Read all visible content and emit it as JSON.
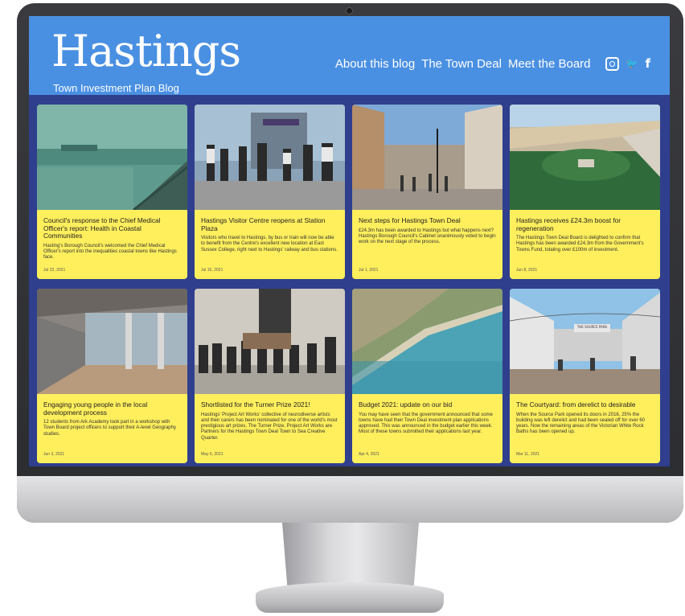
{
  "site": {
    "brand": "Hastings",
    "tagline": "Town Investment Plan Blog",
    "accent_color": "#4a90e2",
    "card_color": "#ffef5d",
    "background_color": "#2f3f8e"
  },
  "nav": {
    "items": [
      "About this blog",
      "The Town Deal",
      "Meet the Board"
    ],
    "social_icons": [
      "instagram-icon",
      "twitter-icon",
      "facebook-icon"
    ],
    "twitter_glyph": "🐦",
    "facebook_glyph": "f"
  },
  "posts": [
    {
      "title": "Council's response to the Chief Medical Officer's report: Health in Coastal Communities",
      "excerpt": "Hasting's Borough Council's welcomed the Chief Medical Officer's report into the inequalities coastal towns like Hastings face.",
      "date": "Jul 22, 2021",
      "image": "seafront-promenade-photo"
    },
    {
      "title": "Hastings Visitor Centre reopens at Station Plaza",
      "excerpt": "Visitors who travel to Hastings, by bus or train will now be able to benefit from the Centre's excellent new location at East Sussex College, right next to Hastings' railway and bus stations.",
      "date": "Jul 15, 2021",
      "image": "group-at-visitor-centre-photo"
    },
    {
      "title": "Next steps for Hastings Town Deal",
      "excerpt": "£24.3m has been awarded to Hastings but what happens next? Hastings Borough Council's Cabinet unanimously voted to begin work on the next stage of the process.",
      "date": "Jul 1, 2021",
      "image": "town-high-street-photo"
    },
    {
      "title": "Hastings receives £24.3m boost for regeneration",
      "excerpt": "The Hastings Town Deal Board is delighted to confirm that Hastings has been awarded £24.3m from the Government's Towns Fund, totaling over £100m of investment.",
      "date": "Jun 8, 2021",
      "image": "coastal-aerial-castle-photo"
    },
    {
      "title": "Engaging young people in the local development process",
      "excerpt": "12 students from Ark Academy took part in a workshop with Town Board project officers to support their A-level Geography studies.",
      "date": "Jun 3, 2021",
      "image": "covered-walkway-photo"
    },
    {
      "title": "Shortlisted for the Turner Prize 2021!",
      "excerpt": "Hastings' Project Art Works' collective of neurodiverse artists and their carers has been nominated for one of the world's most prestigious art prizes. The Turner Prize. Project Art Works are Partners for the Hastings Town Deal Town to Sea Creative Quarter.",
      "date": "May 6, 2021",
      "image": "artists-group-photo"
    },
    {
      "title": "Budget 2021: update on our bid",
      "excerpt": "You may have seen that the government announced that some towns have had their Town Deal investment plan applications approved. This was announced in the budget earlier this week. Most of these towns submitted their applications last year.",
      "date": "Apr 4, 2021",
      "image": "aerial-coastline-photo"
    },
    {
      "title": "The Courtyard: from derelict to desirable",
      "excerpt": "When the Source Park opened its doors in 2016, 25% the building was left derelict and had been sealed off for over 60 years. Now the remaining areas of the Victorian White Rock Baths has been opened up.",
      "date": "Mar 11, 2021",
      "image": "courtyard-cafe-photo",
      "sign_text": "THE SOURCE PARK"
    }
  ]
}
